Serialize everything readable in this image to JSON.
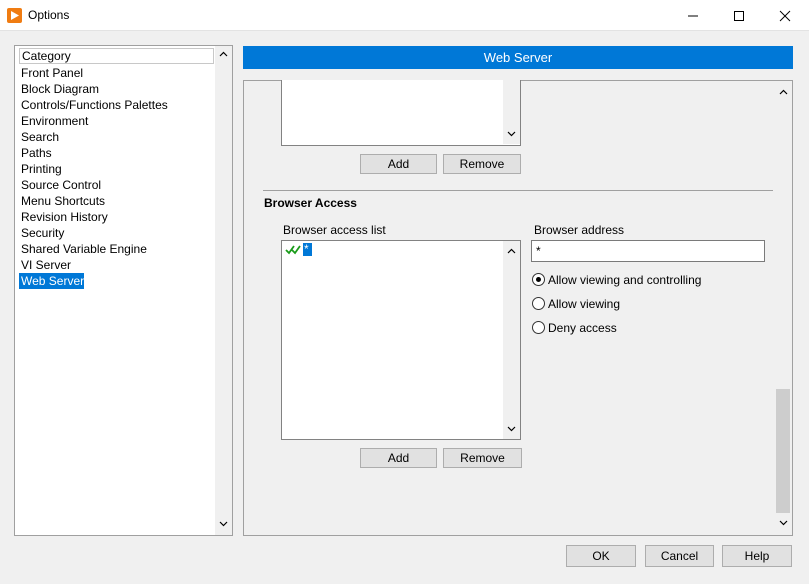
{
  "window": {
    "title": "Options",
    "accent": "#0078d7",
    "icon_color": "#f07c12"
  },
  "category": {
    "header": "Category",
    "items": [
      "Front Panel",
      "Block Diagram",
      "Controls/Functions Palettes",
      "Environment",
      "Search",
      "Paths",
      "Printing",
      "Source Control",
      "Menu Shortcuts",
      "Revision History",
      "Security",
      "Shared Variable Engine",
      "VI Server",
      "Web Server"
    ],
    "selected": "Web Server"
  },
  "panel": {
    "title": "Web Server",
    "top_list": {
      "add_label": "Add",
      "remove_label": "Remove"
    },
    "browser_access": {
      "section_title": "Browser Access",
      "list_label": "Browser access list",
      "entries": [
        {
          "value": "*",
          "status_icon": "allow-view-control-check-icon"
        }
      ],
      "address_label": "Browser address",
      "address_value": "*",
      "options": [
        {
          "label": "Allow viewing and controlling",
          "checked": true
        },
        {
          "label": "Allow viewing",
          "checked": false
        },
        {
          "label": "Deny access",
          "checked": false
        }
      ],
      "add_label": "Add",
      "remove_label": "Remove"
    }
  },
  "footer": {
    "ok_label": "OK",
    "cancel_label": "Cancel",
    "help_label": "Help"
  }
}
